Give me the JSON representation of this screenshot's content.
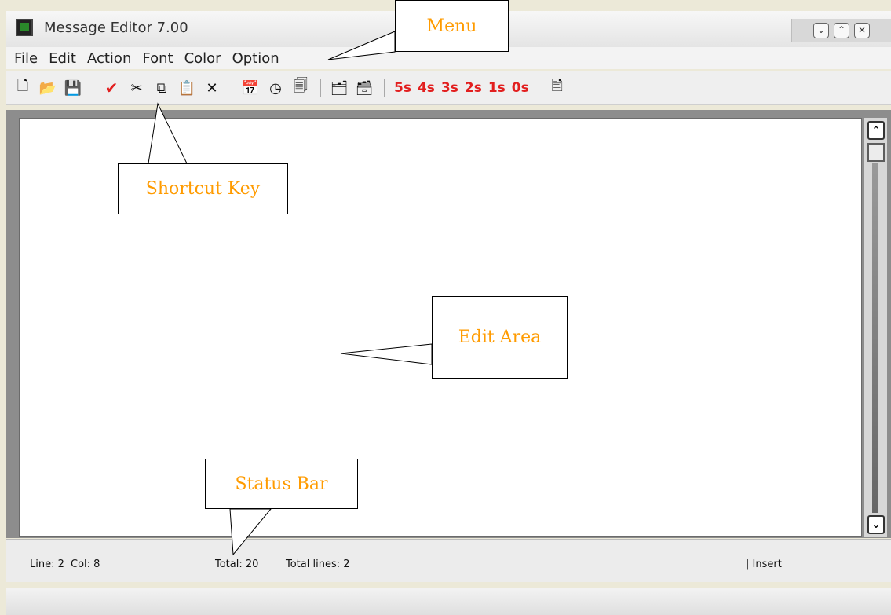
{
  "window": {
    "title": "Message Editor 7.00"
  },
  "menu": [
    "File",
    "Edit",
    "Action",
    "Font",
    "Color",
    "Option"
  ],
  "toolbar": {
    "red_items": [
      "5s",
      "4s",
      "3s",
      "2s",
      "1s",
      "0s"
    ]
  },
  "status": {
    "line": "Line: 2",
    "col": "Col: 8",
    "total": "Total: 20",
    "total_lines": "Total lines: 2",
    "mode": "| Insert"
  },
  "annotations": {
    "menu": "Menu",
    "shortcut": "Shortcut Key",
    "edit_area": "Edit Area",
    "status_bar": "Status Bar"
  },
  "icons": {
    "window": "app-icon",
    "new": "new-file-icon",
    "open": "open-folder-icon",
    "save": "save-icon",
    "check": "checkmark-icon",
    "cut": "scissors-icon",
    "copy": "copy-icon",
    "paste": "paste-icon",
    "delete": "delete-icon",
    "calendar": "calendar-icon",
    "clock": "clock-icon",
    "pages": "pages-icon",
    "import": "import-icon",
    "export": "export-icon",
    "preview": "preview-icon"
  },
  "colors": {
    "accent": "#ff9b00",
    "red": "#e21f1f"
  }
}
